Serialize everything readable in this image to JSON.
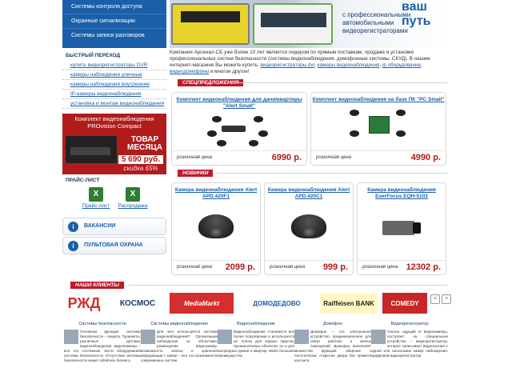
{
  "nav": {
    "items": [
      "Системы контроля доступа",
      "Охранные сигнализации",
      "Системы записи разговоров"
    ]
  },
  "hero": {
    "title": "ваш путь",
    "subtitle": "с профессиональными автомобильными видеорегистраторами"
  },
  "quick": {
    "title": "БЫСТРЫЙ ПЕРЕХОД",
    "links": [
      "купить видеорегистраторы DVR",
      "камеры наблюдения уличные",
      "камеры наблюдения внутренние",
      "IP-камеры видеонаблюдения",
      "установка и монтаж видеонаблюдения"
    ]
  },
  "ad": {
    "line1": "Комплект видеонаблюдения",
    "line2": "PROvision Compact",
    "month1": "ТОВАР",
    "month2": "МЕСЯЦА",
    "price": "5 690 руб.",
    "discount": "скидка 65%"
  },
  "pricelist": {
    "title": "ПРАЙС-ЛИСТ",
    "items": [
      "Прайс-лист",
      "Распродажа"
    ]
  },
  "buttons": {
    "vacancies": "ВАКАНСИИ",
    "security": "ПУЛЬТОВАЯ ОХРАНА"
  },
  "intro": {
    "text": "Компания Арсенал-СБ уже более 10 лет является лидером по прямым поставкам, продаже и установке профессиональных систем безопасности (системы видеонаблюдения, домофонные системы, СКУД). В нашем интернет-магазине Вы можете купить:",
    "link1": "видеорегистраторы dvr",
    "link2": "камеры видеонаблюдения",
    "link3": "ip оборудование",
    "link4": "видеодомофоны",
    "tail": "и многое другое!"
  },
  "sections": {
    "specials": "СПЕЦПРЕДЛОЖЕНИЯ",
    "new": "НОВИНКИ",
    "clients": "НАШИ КЛИЕНТЫ"
  },
  "price_label": "розничная цена",
  "specials": [
    {
      "name": "Комплект видеонаблюдения для дачи/квартиры \"Alert Small\"",
      "price": "6990 р."
    },
    {
      "name": "Комплект видеонаблюдения на базе ПК \"PC Small\"",
      "price": "4990 р."
    }
  ],
  "new_items": [
    {
      "name": "Камера видеонаблюдения Alert APD.420F1",
      "price": "2099 р."
    },
    {
      "name": "Камера видеонаблюдения Alert APD.420C1",
      "price": "999 р."
    },
    {
      "name": "Камера видеонаблюдения EverFocus EQH-5102",
      "price": "12302 р."
    }
  ],
  "clients": {
    "logos": [
      "РЖД",
      "КОСМОС",
      "MediaMarkt",
      "ДОМОДЕДОВО",
      "Raiffeisen BANK",
      "COMEDY"
    ],
    "prev": "<",
    "next": ">"
  },
  "bottom": [
    {
      "title": "Системы безопасности",
      "text": "Основная функция системы безопасности – защита. Турникеты, различные датчики, видеонаблюдение, видеокамеры – все это составные части оборудования системы безопасности. Отсутствие системы безопасности может обойтись бизнесу"
    },
    {
      "title": "Системы видеонаблюдения",
      "text": "Для чего используется система видеонаблюдения? Организация наблюдения за объектами, размещение видеокамер, возможность записи и хранения информации с камер – все это возможности современных систем"
    },
    {
      "title": "Видеонаблюдение",
      "text": "Видеонаблюдение становится все более популярным и используется не только для охраны офисов, промышленных объектов, но и для загородных домов и квартир. Имея большое преимущество"
    },
    {
      "title": "Домофон",
      "text": "Домофон – это электронное устройство, предназначенное для связи рабочих и жилых помещений. Домофон выполняет множество функций: общение с посетителем, открытие двери без прямого контакта"
    },
    {
      "title": "Видеорегистратор",
      "text": "Сигнал, идущий от видеокамеры, поступает на специальное устройство – видеорегистратор, которое записывает видеосигнал с одной или нескольких камер наблюдения. Цифровой видеорегистратор"
    }
  ]
}
